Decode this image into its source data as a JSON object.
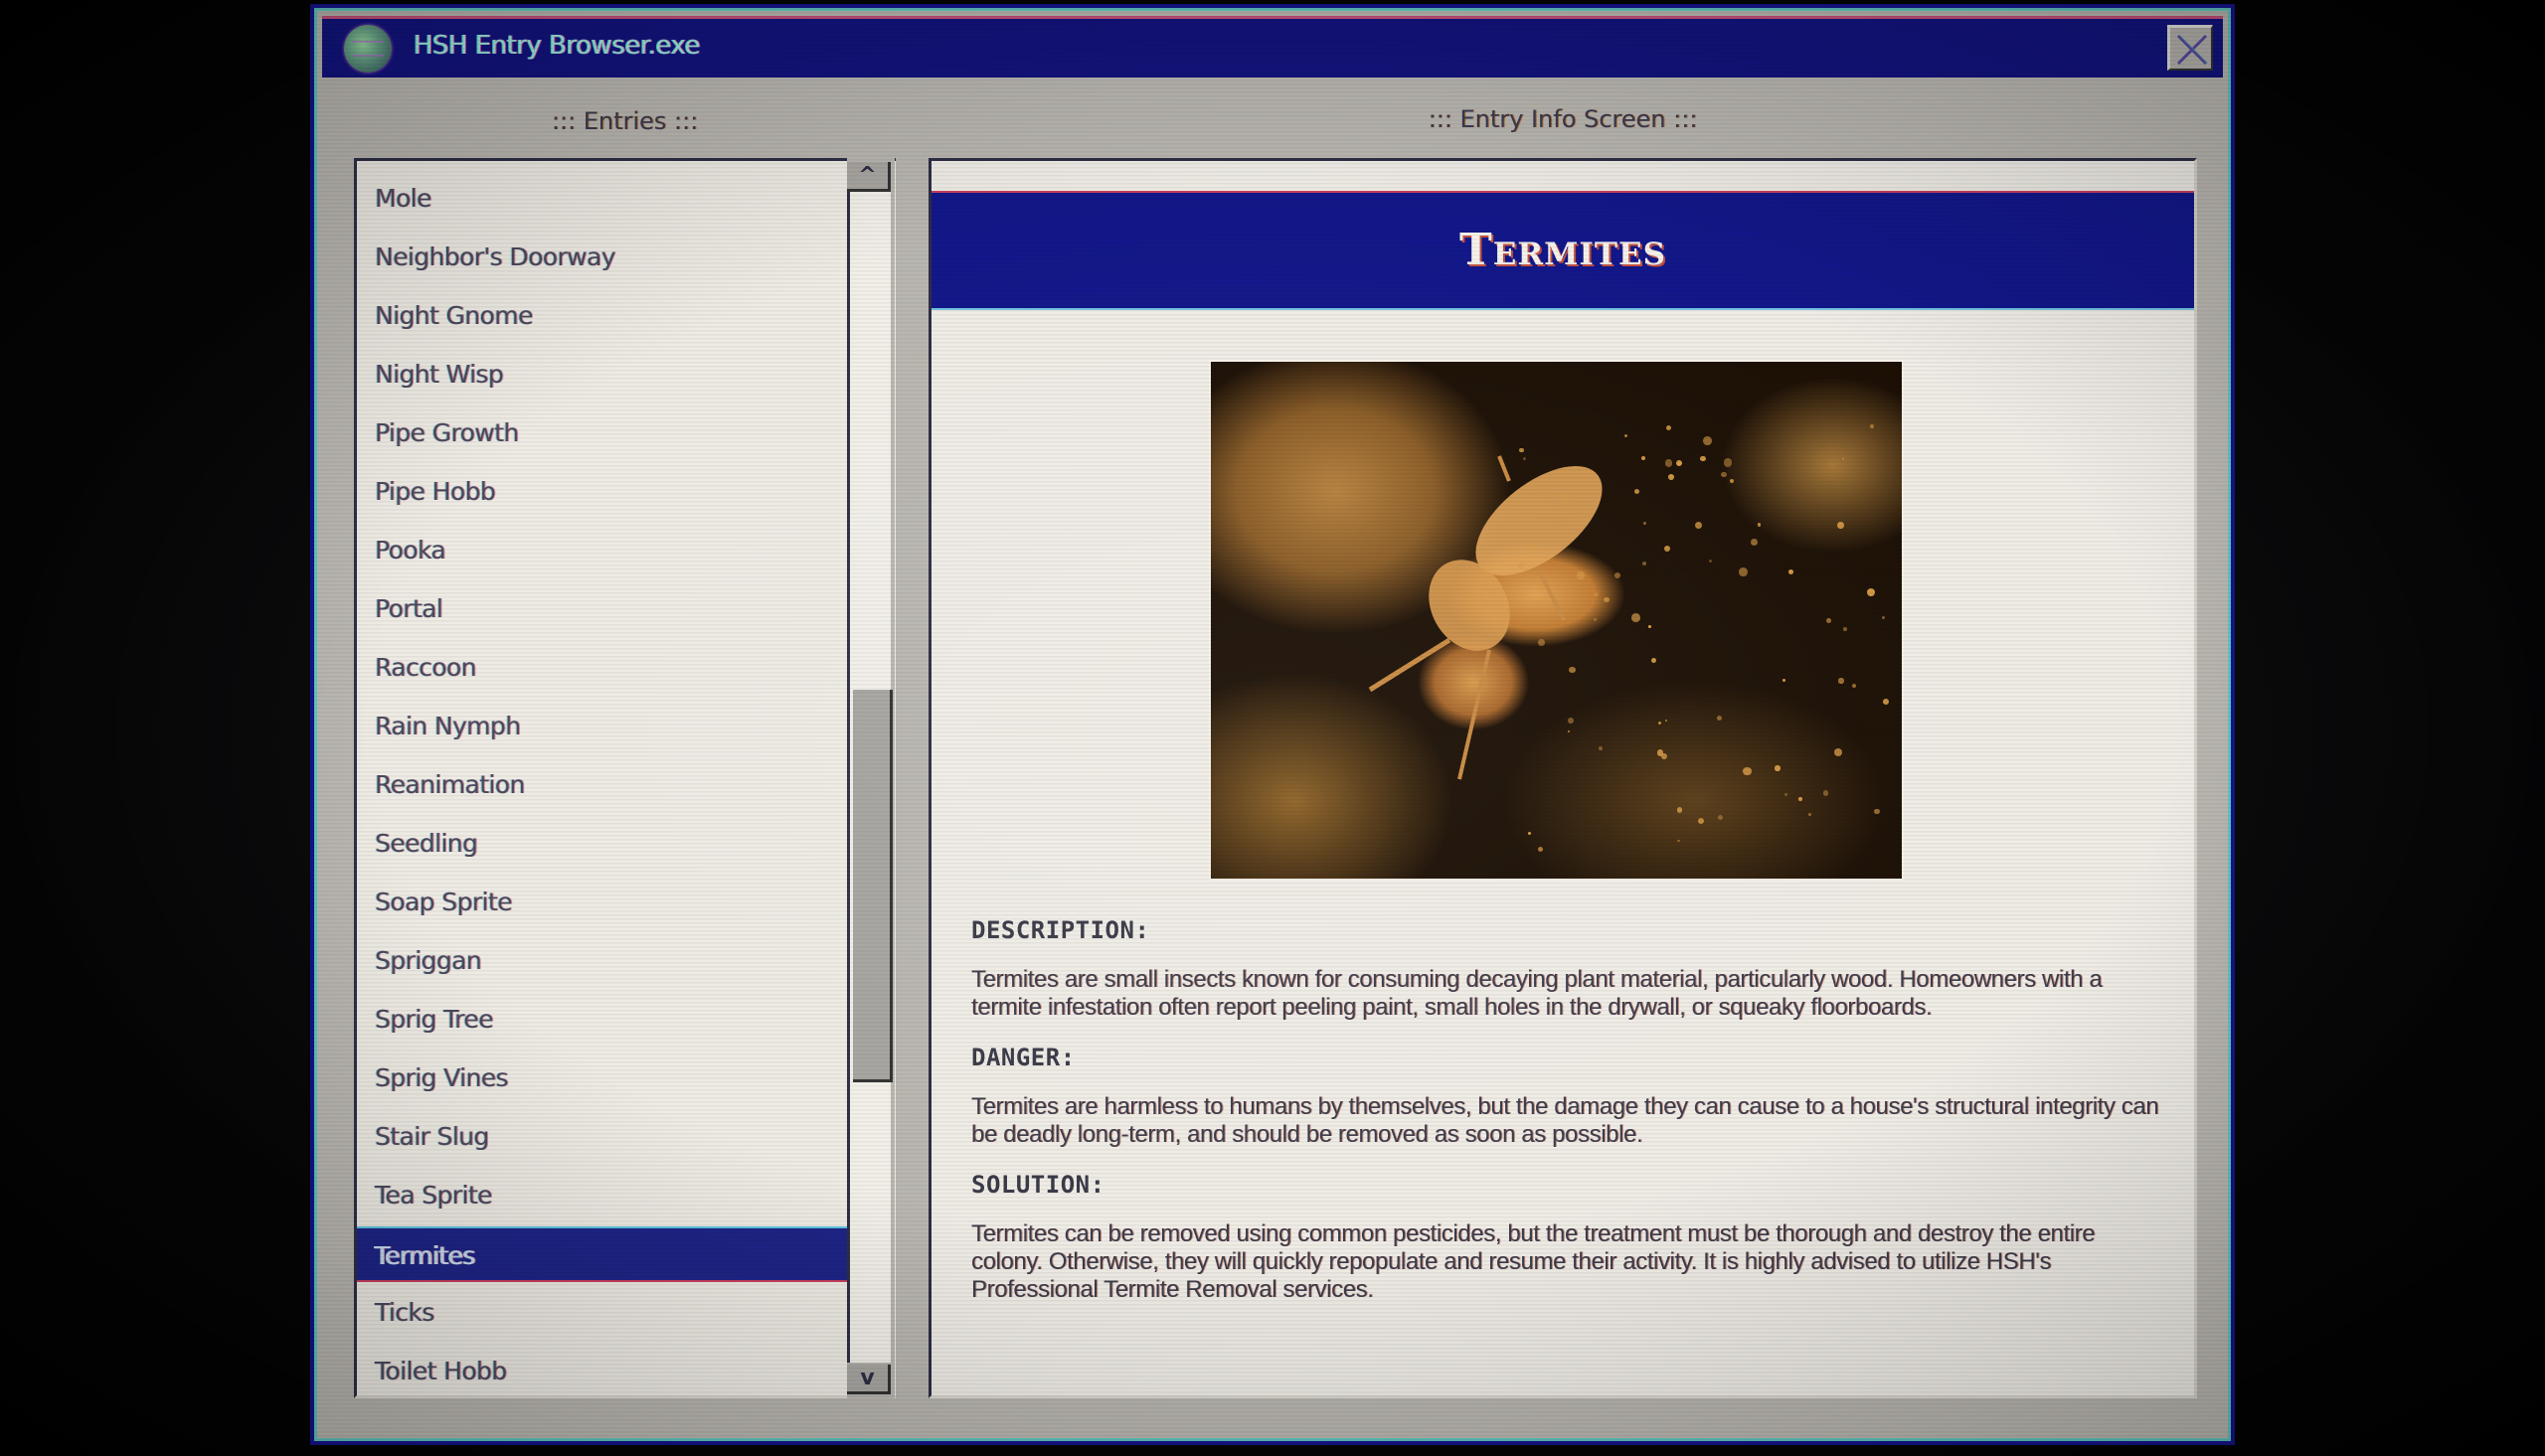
{
  "window": {
    "title": "HSH Entry Browser.exe",
    "icon": "brain-globe-icon",
    "close_icon": "close-x-icon"
  },
  "entries_panel": {
    "label": "::: Entries :::",
    "selected": "Termites",
    "items": [
      "Mole",
      "Neighbor's Doorway",
      "Night Gnome",
      "Night Wisp",
      "Pipe Growth",
      "Pipe Hobb",
      "Pooka",
      "Portal",
      "Raccoon",
      "Rain Nymph",
      "Reanimation",
      "Seedling",
      "Soap Sprite",
      "Spriggan",
      "Sprig Tree",
      "Sprig Vines",
      "Stair Slug",
      "Tea Sprite",
      "Termites",
      "Ticks",
      "Toilet Hobb"
    ],
    "scroll_up_label": "^",
    "scroll_down_label": "v",
    "scroll_position": 0.64
  },
  "info_panel": {
    "label": "::: Entry Info Screen :::",
    "entry_title": "Termites",
    "image_alt": "Close-up photo of a termite in soil",
    "sections": [
      {
        "heading": "DESCRIPTION:",
        "body": "Termites are small insects known for consuming decaying plant material, particularly wood. Homeowners with a termite infestation often report peeling paint, small holes in the drywall, or squeaky floorboards."
      },
      {
        "heading": "DANGER:",
        "body": "Termites are harmless to humans by themselves, but the damage they can cause to a house's structural integrity can be deadly long-term, and should be removed as soon as possible."
      },
      {
        "heading": "SOLUTION:",
        "body": "Termites can be removed using common pesticides, but the treatment must be thorough and destroy the entire colony. Otherwise, they will quickly repopulate and resume their activity. It is highly advised to utilize HSH's Professional Termite Removal services."
      }
    ]
  },
  "colors": {
    "titlebar": "#12137e",
    "selection": "#1e2486",
    "window_bg": "#b9b6b0",
    "panel_bg": "#efece6"
  }
}
